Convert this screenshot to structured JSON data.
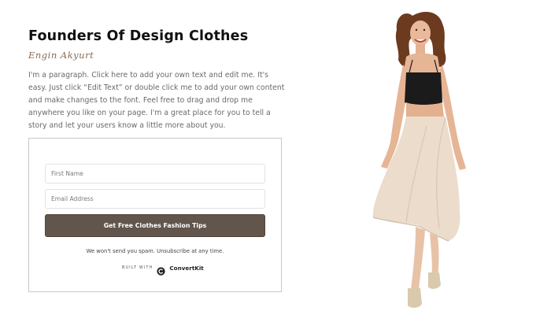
{
  "header": {
    "title": "Founders Of Design Clothes",
    "signature": "Engin Akyurt",
    "paragraph": "I'm a paragraph. Click here to add your own text and edit me. It's easy. Just click “Edit Text” or double click me to add your own content and make changes to the font. Feel free to drag and drop me anywhere you like on your page. I'm a great place for you to tell a story and let your users know a little more about you."
  },
  "form": {
    "first_name_placeholder": "First Name",
    "email_placeholder": "Email Address",
    "submit_label": "Get Free Clothes Fashion Tips",
    "spam_note": "We won't send you spam. Unsubscribe at any time.",
    "built_with": "BUILT WITH",
    "provider": "ConvertKit"
  },
  "icons": {
    "provider_logo": "convertkit-logo-icon"
  },
  "colors": {
    "button_bg": "#62564c",
    "signature": "#8a6a52",
    "skirt": "#ecdccb",
    "top": "#1a1a1a"
  }
}
